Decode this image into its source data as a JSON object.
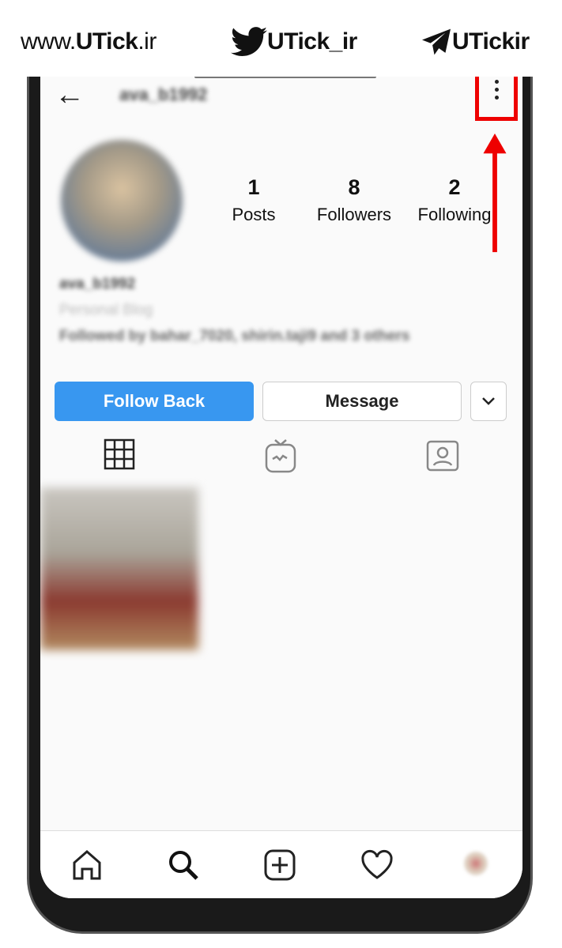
{
  "watermark": {
    "website_prefix": "www.",
    "website_bold": "UTick",
    "website_suffix": ".ir",
    "twitter_handle": "UTick_ir",
    "telegram_handle": "UTickir"
  },
  "profile": {
    "username_title": "ava_b1992",
    "stats": [
      {
        "value": "1",
        "label": "Posts"
      },
      {
        "value": "8",
        "label": "Followers"
      },
      {
        "value": "2",
        "label": "Following"
      }
    ],
    "name": "ava_b1992",
    "category": "Personal Blog",
    "followed_by": "Followed by bahar_7020, shirin.taji9 and 3 others"
  },
  "buttons": {
    "follow_back": "Follow Back",
    "message": "Message"
  },
  "colors": {
    "follow_button": "#3897f0",
    "highlight": "#e00000"
  },
  "tabs": [
    "grid-icon",
    "igtv-icon",
    "tagged-icon"
  ],
  "bottom_nav": [
    "home-icon",
    "search-icon",
    "add-icon",
    "heart-icon",
    "profile-avatar"
  ]
}
